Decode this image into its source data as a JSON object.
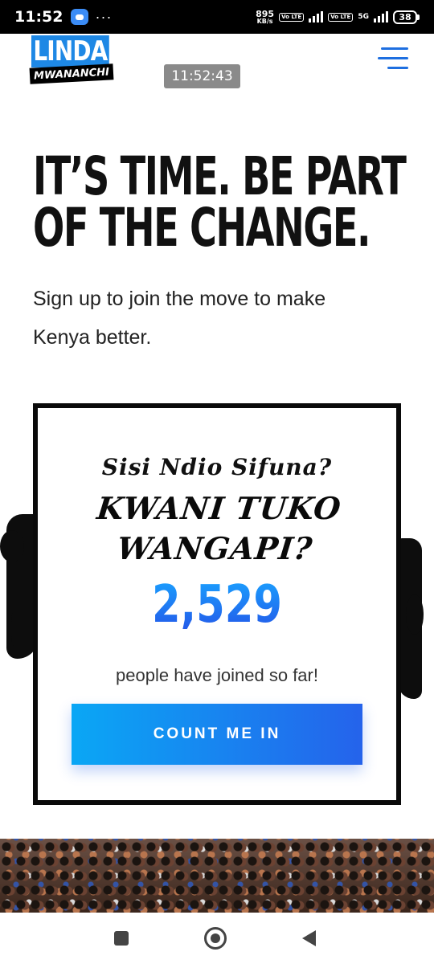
{
  "status_bar": {
    "time": "11:52",
    "more": "···",
    "net_speed_value": "895",
    "net_speed_unit": "KB/s",
    "volte1": "Vo LTE",
    "volte2": "Vo LTE",
    "network_gen": "5G",
    "battery": "38"
  },
  "header": {
    "logo_top": "LINDA",
    "logo_bottom": "MWANANCHI",
    "time_overlay": "11:52:43"
  },
  "hero": {
    "title": "IT’S TIME. BE PART OF THE CHANGE.",
    "subtitle": "Sign up to join the move to make Kenya better."
  },
  "card": {
    "line1": "Sisi Ndio Sifuna?",
    "line2": "KWANI TUKO WANGAPI?",
    "count": "2,529",
    "count_label": "people have joined so far!",
    "cta_label": "COUNT ME IN"
  },
  "colors": {
    "brand_blue": "#1e88e5",
    "cta_gradient_start": "#0aa7f5",
    "cta_gradient_end": "#2563eb",
    "text_dark": "#111111"
  },
  "icons": {
    "menu": "hamburger-menu-icon",
    "nav_recents": "square-icon",
    "nav_home": "circle-icon",
    "nav_back": "triangle-back-icon"
  }
}
